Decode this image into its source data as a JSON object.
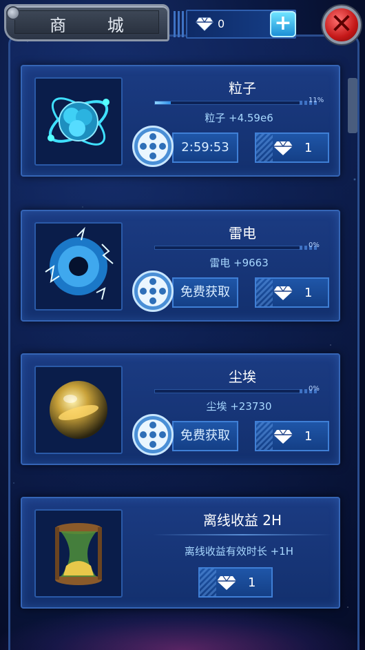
{
  "header": {
    "title": "商 城",
    "gems": "0",
    "add_label": "+",
    "close_label": "✕"
  },
  "items": [
    {
      "name": "粒子",
      "progress": 0.11,
      "progress_label": "11%",
      "bonus": "粒子 +4.59e6",
      "action": "2:59:53",
      "price": "1"
    },
    {
      "name": "雷电",
      "progress": 0,
      "progress_label": "0%",
      "bonus": "雷电 +9663",
      "action": "免费获取",
      "price": "1"
    },
    {
      "name": "尘埃",
      "progress": 0,
      "progress_label": "0%",
      "bonus": "尘埃 +23730",
      "action": "免费获取",
      "price": "1"
    },
    {
      "name": "离线收益 2H",
      "bonus": "离线收益有效时长 +1H",
      "price": "1"
    }
  ],
  "colors": {
    "accent": "#3f7fd6",
    "close": "#c41818",
    "plus": "#1c8fd6"
  }
}
